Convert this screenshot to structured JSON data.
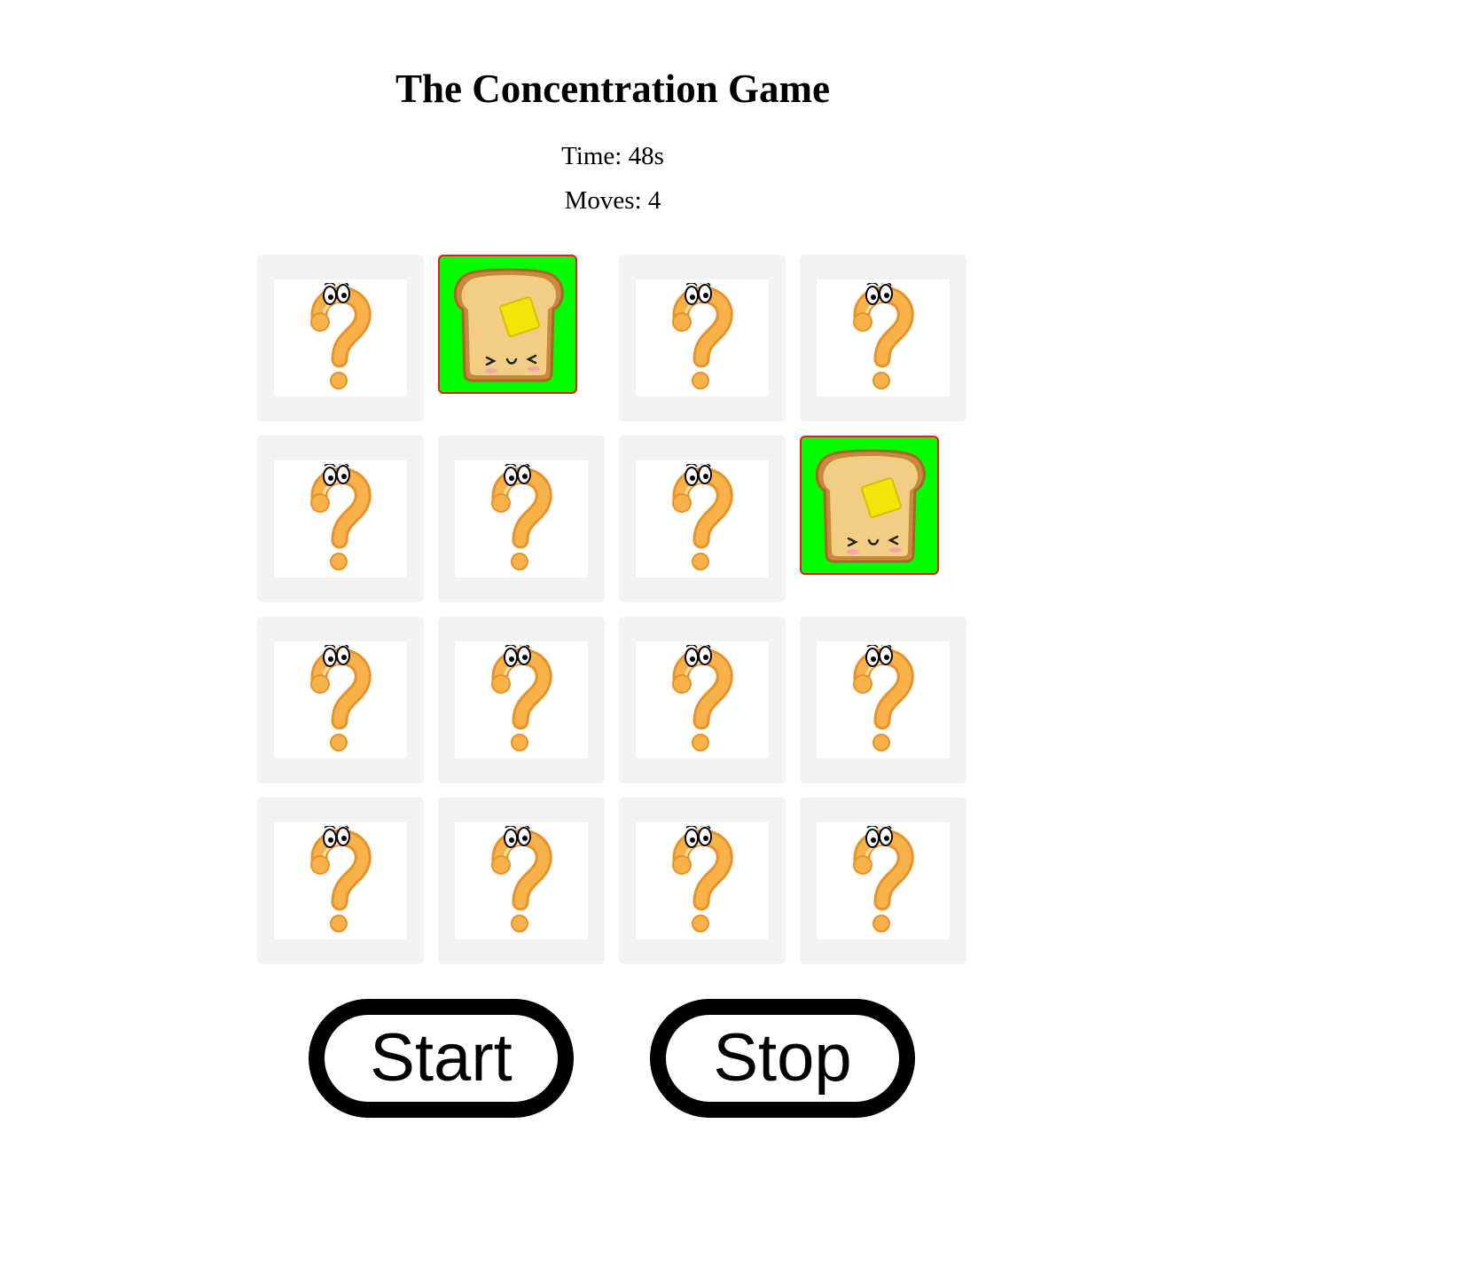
{
  "header": {
    "title": "The Concentration Game"
  },
  "stats": {
    "time": "Time: 48s",
    "moves": "Moves: 4"
  },
  "board": {
    "rows": 4,
    "columns": 4,
    "cards": [
      {
        "state": "hidden",
        "icon": "question-mark-icon"
      },
      {
        "state": "revealed",
        "icon": "toast-icon"
      },
      {
        "state": "hidden",
        "icon": "question-mark-icon"
      },
      {
        "state": "hidden",
        "icon": "question-mark-icon"
      },
      {
        "state": "hidden",
        "icon": "question-mark-icon"
      },
      {
        "state": "hidden",
        "icon": "question-mark-icon"
      },
      {
        "state": "hidden",
        "icon": "question-mark-icon"
      },
      {
        "state": "revealed",
        "icon": "toast-icon"
      },
      {
        "state": "hidden",
        "icon": "question-mark-icon"
      },
      {
        "state": "hidden",
        "icon": "question-mark-icon"
      },
      {
        "state": "hidden",
        "icon": "question-mark-icon"
      },
      {
        "state": "hidden",
        "icon": "question-mark-icon"
      },
      {
        "state": "hidden",
        "icon": "question-mark-icon"
      },
      {
        "state": "hidden",
        "icon": "question-mark-icon"
      },
      {
        "state": "hidden",
        "icon": "question-mark-icon"
      },
      {
        "state": "hidden",
        "icon": "question-mark-icon"
      }
    ]
  },
  "controls": {
    "start_label": "Start",
    "stop_label": "Stop"
  },
  "colors": {
    "card_back": "#f2f2f2",
    "revealed_bg": "#00ff00",
    "revealed_border": "#e02020",
    "question_orange": "#f5a73b",
    "button_border": "#000000"
  }
}
